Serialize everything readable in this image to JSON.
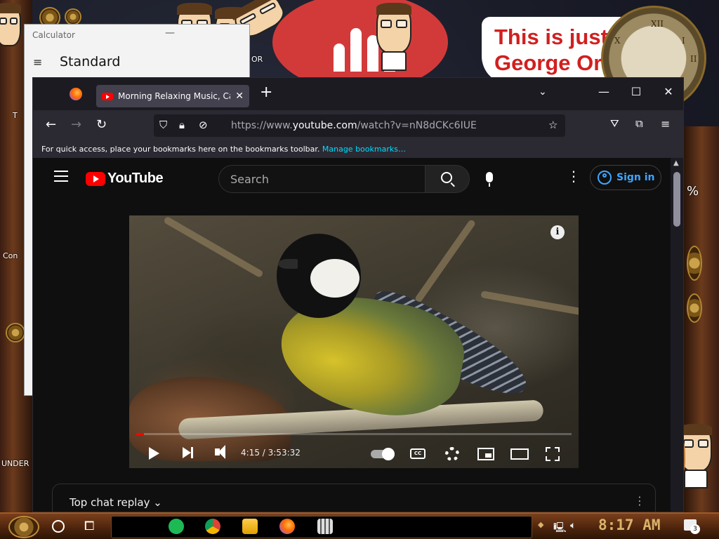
{
  "desktop": {
    "meme_text": "This is just\nGeorge Or",
    "side_text_t": "T",
    "side_text_con": "Con",
    "side_text_under": "UNDER",
    "side_text_or": "OR",
    "side_text_percent": "%"
  },
  "calculator": {
    "title": "Calculator",
    "mode": "Standard",
    "menu_icon": "≡",
    "minimize": "—"
  },
  "firefox": {
    "tab": {
      "title": "Morning Relaxing Music, Calm",
      "close": "✕"
    },
    "new_tab": "+",
    "list_tabs": "⌄",
    "window_controls": {
      "minimize": "—",
      "maximize": "☐",
      "close": "✕"
    },
    "nav": {
      "back": "←",
      "forward": "→",
      "reload": "↻"
    },
    "url": {
      "prefix": "https://www.",
      "domain": "youtube.com",
      "path": "/watch?v=nN8dCKc6IUE"
    },
    "bookmarks_bar": {
      "text": "For quick access, place your bookmarks here on the bookmarks toolbar.",
      "link": "Manage bookmarks…"
    }
  },
  "youtube": {
    "logo_text": "YouTube",
    "search_placeholder": "Search",
    "more": "⋮",
    "sign_in": "Sign in",
    "info": "i",
    "video": {
      "time_current": "4:15",
      "time_total": "3:53:32",
      "progress": 0.018,
      "cc_label": "CC"
    },
    "chat": {
      "title": "Top chat replay",
      "chevron": "⌄",
      "more": "⋮"
    }
  },
  "taskbar": {
    "clock": "8:17 AM",
    "notifications": "3",
    "apps": [
      "sheets-icon",
      "chrome-icon",
      "file-explorer-icon",
      "firefox-icon",
      "calculator-icon"
    ]
  },
  "colors": {
    "yt_red": "#ff0000",
    "yt_link": "#3ea6ff",
    "ff_link": "#00ddff",
    "clock": "#d9b36a"
  }
}
